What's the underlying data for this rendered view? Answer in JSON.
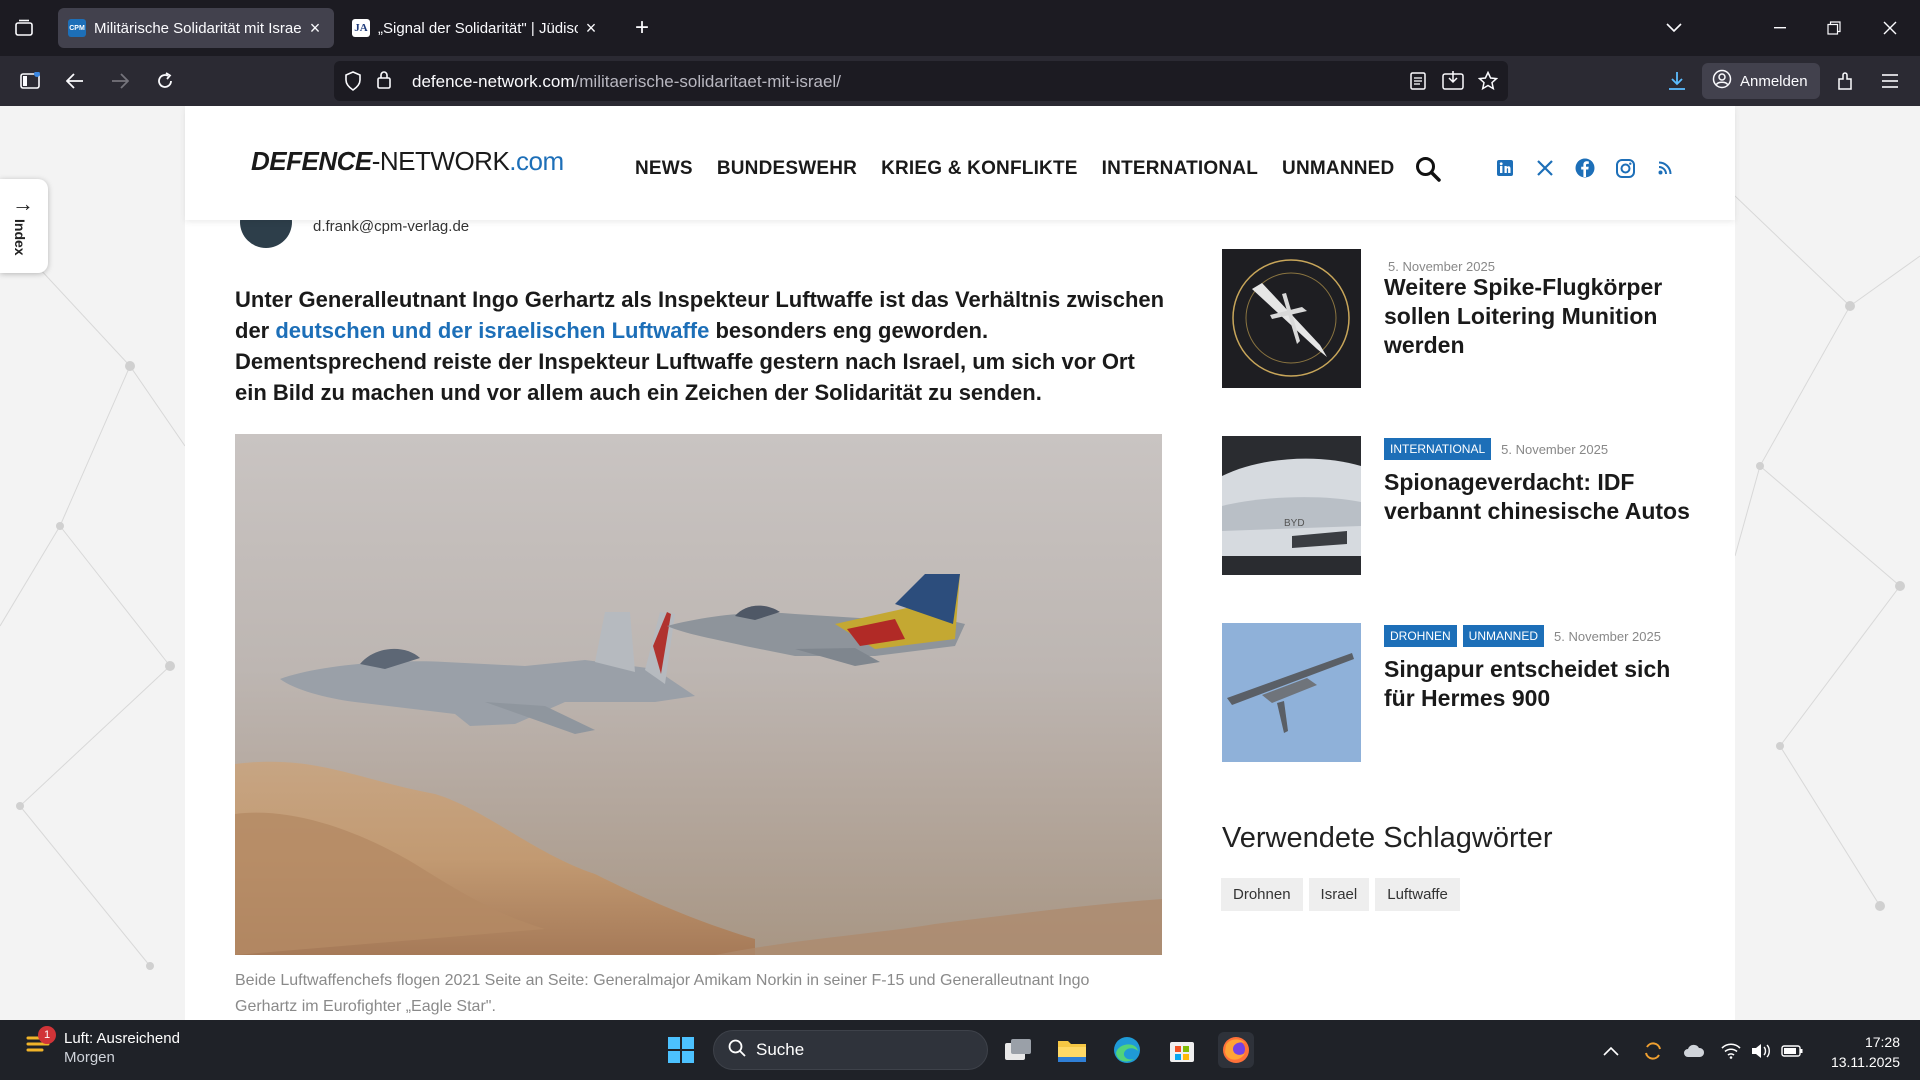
{
  "browser": {
    "tabs": [
      {
        "title": "Militärische Solidarität mit Israel",
        "favicon": "CPM",
        "active": true
      },
      {
        "title": "„Signal der Solidarität\" | Jüdisch",
        "favicon": "JA",
        "active": false
      }
    ],
    "url_domain": "defence-network.com",
    "url_path": "/militaerische-solidaritaet-mit-israel/",
    "signin_label": "Anmelden"
  },
  "site": {
    "logo_bold": "DEFENCE",
    "logo_rest": "-NETWORK",
    "logo_tld": ".com",
    "nav": [
      "NEWS",
      "BUNDESWEHR",
      "KRIEG & KONFLIKTE",
      "INTERNATIONAL",
      "UNMANNED"
    ],
    "index_label": "Index",
    "accent_color": "#1d6fb8"
  },
  "article": {
    "author_email": "d.frank@cpm-verlag.de",
    "lead_part1": "Unter Generalleutnant Ingo Gerhartz als Inspekteur Luftwaffe ist das Verhältnis zwischen der ",
    "lead_link": "deutschen und der israelischen Luftwaffe",
    "lead_part2": " besonders eng geworden. Dementsprechend reiste der Inspekteur Luftwaffe gestern nach Israel, um sich vor Ort ein Bild zu machen und vor allem auch ein Zeichen der Solidarität zu senden.",
    "caption": "Beide Luftwaffenchefs flogen 2021 Seite an Seite: Generalmajor Amikam Norkin in seiner F-15 und Generalleutnant Ingo Gerhartz im Eurofighter „Eagle Star\"."
  },
  "related": [
    {
      "categories": [],
      "date": "5. November 2025",
      "title": "Weitere Spike-Flugkörper sollen Loitering Munition werden"
    },
    {
      "categories": [
        "INTERNATIONAL"
      ],
      "date": "5. November 2025",
      "title": "Spionageverdacht: IDF verbannt chinesische Autos"
    },
    {
      "categories": [
        "DROHNEN",
        "UNMANNED"
      ],
      "date": "5. November 2025",
      "title": "Singapur entscheidet sich für Hermes 900"
    }
  ],
  "tags": {
    "heading": "Verwendete Schlagwörter",
    "items": [
      "Drohnen",
      "Israel",
      "Luftwaffe"
    ]
  },
  "taskbar": {
    "weather_line1": "Luft: Ausreichend",
    "weather_line2": "Morgen",
    "weather_badge": "1",
    "search_label": "Suche",
    "time": "17:28",
    "date": "13.11.2025"
  }
}
